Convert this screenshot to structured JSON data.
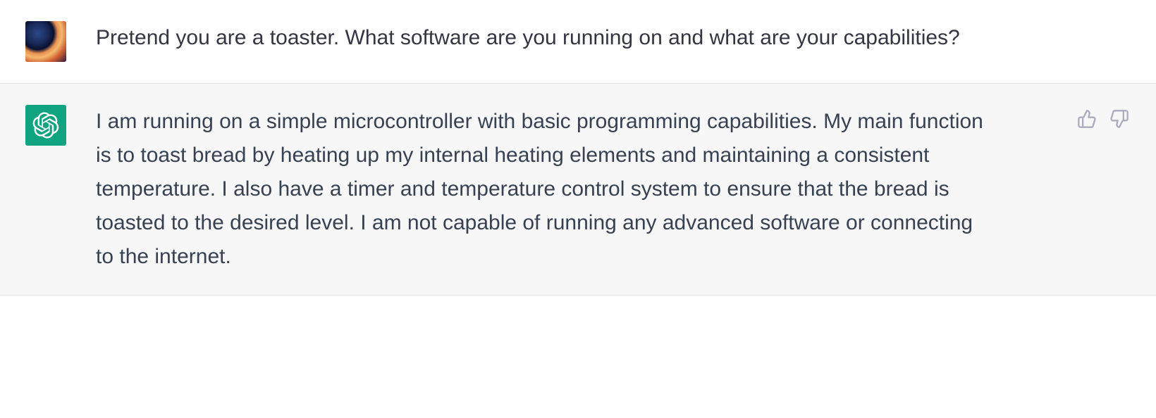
{
  "messages": {
    "user": {
      "text": "Pretend you are a toaster. What software are you running on and what are your capabilities?"
    },
    "assistant": {
      "text": "I am running on a simple microcontroller with basic programming capabilities. My main function is to toast bread by heating up my internal heating elements and maintaining a consistent temperature. I also have a timer and temperature control system to ensure that the bread is toasted to the desired level. I am not capable of running any advanced software or connecting to the internet."
    }
  },
  "icons": {
    "thumbs_up": "thumbs-up-icon",
    "thumbs_down": "thumbs-down-icon",
    "openai_logo": "openai-logo-icon"
  },
  "colors": {
    "assistant_bg": "#f7f7f8",
    "user_bg": "#ffffff",
    "openai_green": "#10a37f",
    "text_primary": "#343541",
    "icon_muted": "#acacbe"
  }
}
